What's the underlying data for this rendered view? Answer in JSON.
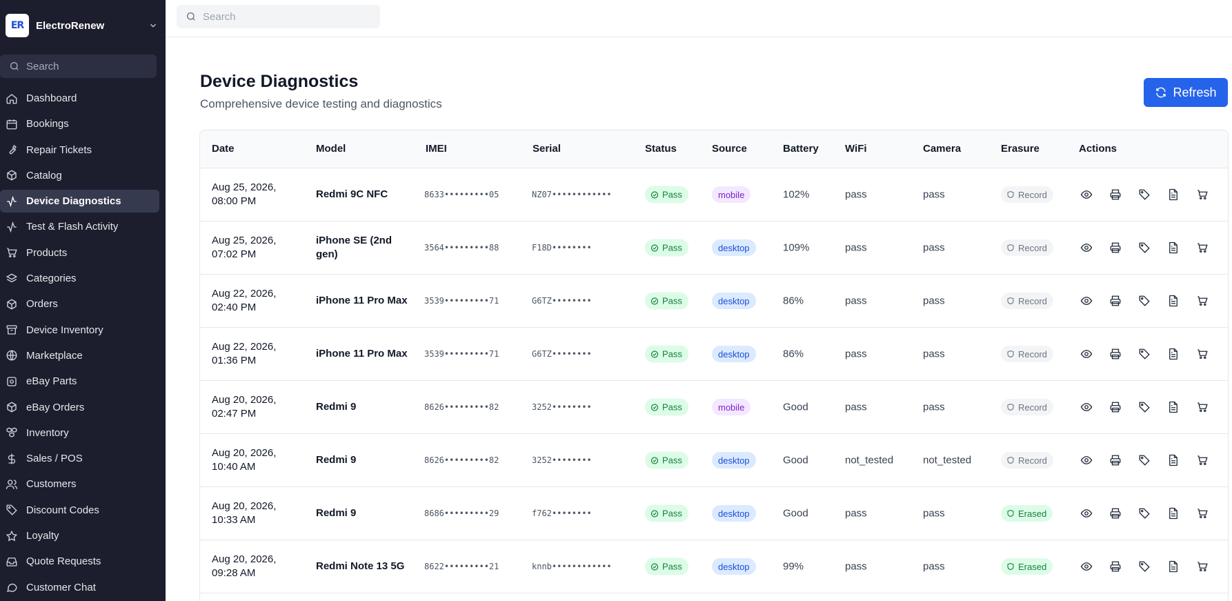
{
  "sidebar": {
    "brand_name": "ElectroRenew",
    "search_placeholder": "Search",
    "items": [
      {
        "label": "Dashboard",
        "icon": "home-icon"
      },
      {
        "label": "Bookings",
        "icon": "calendar-icon"
      },
      {
        "label": "Repair Tickets",
        "icon": "wrench-icon"
      },
      {
        "label": "Catalog",
        "icon": "box-icon"
      },
      {
        "label": "Device Diagnostics",
        "icon": "activity-icon",
        "active": true
      },
      {
        "label": "Test & Flash Activity",
        "icon": "activity-icon"
      },
      {
        "label": "Products",
        "icon": "cart-icon"
      },
      {
        "label": "Categories",
        "icon": "layers-icon"
      },
      {
        "label": "Orders",
        "icon": "box-icon"
      },
      {
        "label": "Device Inventory",
        "icon": "archive-icon"
      },
      {
        "label": "Marketplace",
        "icon": "globe-icon"
      },
      {
        "label": "eBay Parts",
        "icon": "settings-icon"
      },
      {
        "label": "eBay Orders",
        "icon": "box-icon"
      },
      {
        "label": "Inventory",
        "icon": "boxes-icon"
      },
      {
        "label": "Sales / POS",
        "icon": "dollar-icon"
      },
      {
        "label": "Customers",
        "icon": "users-icon"
      },
      {
        "label": "Discount Codes",
        "icon": "tag-icon"
      },
      {
        "label": "Loyalty",
        "icon": "star-icon"
      },
      {
        "label": "Quote Requests",
        "icon": "inbox-icon"
      },
      {
        "label": "Customer Chat",
        "icon": "chat-icon"
      }
    ]
  },
  "topbar": {
    "search_placeholder": "Search"
  },
  "header": {
    "title": "Device Diagnostics",
    "subtitle": "Comprehensive device testing and diagnostics",
    "refresh_label": "Refresh"
  },
  "table": {
    "columns": [
      "Date",
      "Model",
      "IMEI",
      "Serial",
      "Status",
      "Source",
      "Battery",
      "WiFi",
      "Camera",
      "Erasure",
      "Actions"
    ],
    "rows": [
      {
        "date": "Aug 25, 2026, 08:00 PM",
        "model": "Redmi 9C NFC",
        "imei": "8633•••••••••05",
        "serial": "NZ07••••••••••••",
        "status": "Pass",
        "source": "mobile",
        "battery": "102%",
        "wifi": "pass",
        "camera": "pass",
        "erasure": "Record"
      },
      {
        "date": "Aug 25, 2026, 07:02 PM",
        "model": "iPhone SE (2nd gen)",
        "imei": "3564•••••••••88",
        "serial": "F18D••••••••",
        "status": "Pass",
        "source": "desktop",
        "battery": "109%",
        "wifi": "pass",
        "camera": "pass",
        "erasure": "Record"
      },
      {
        "date": "Aug 22, 2026, 02:40 PM",
        "model": "iPhone 11 Pro Max",
        "imei": "3539•••••••••71",
        "serial": "G6TZ••••••••",
        "status": "Pass",
        "source": "desktop",
        "battery": "86%",
        "wifi": "pass",
        "camera": "pass",
        "erasure": "Record"
      },
      {
        "date": "Aug 22, 2026, 01:36 PM",
        "model": "iPhone 11 Pro Max",
        "imei": "3539•••••••••71",
        "serial": "G6TZ••••••••",
        "status": "Pass",
        "source": "desktop",
        "battery": "86%",
        "wifi": "pass",
        "camera": "pass",
        "erasure": "Record"
      },
      {
        "date": "Aug 20, 2026, 02:47 PM",
        "model": "Redmi 9",
        "imei": "8626•••••••••82",
        "serial": "3252••••••••",
        "status": "Pass",
        "source": "mobile",
        "battery": "Good",
        "wifi": "pass",
        "camera": "pass",
        "erasure": "Record"
      },
      {
        "date": "Aug 20, 2026, 10:40 AM",
        "model": "Redmi 9",
        "imei": "8626•••••••••82",
        "serial": "3252••••••••",
        "status": "Pass",
        "source": "desktop",
        "battery": "Good",
        "wifi": "not_tested",
        "camera": "not_tested",
        "erasure": "Record"
      },
      {
        "date": "Aug 20, 2026, 10:33 AM",
        "model": "Redmi 9",
        "imei": "8686•••••••••29",
        "serial": "f762••••••••",
        "status": "Pass",
        "source": "desktop",
        "battery": "Good",
        "wifi": "pass",
        "camera": "pass",
        "erasure": "Erased"
      },
      {
        "date": "Aug 20, 2026, 09:28 AM",
        "model": "Redmi Note 13 5G",
        "imei": "8622•••••••••21",
        "serial": "knnb••••••••••••",
        "status": "Pass",
        "source": "desktop",
        "battery": "99%",
        "wifi": "pass",
        "camera": "pass",
        "erasure": "Erased"
      }
    ],
    "action_icons": [
      "eye-icon",
      "printer-icon",
      "tag-icon",
      "document-icon",
      "cart-icon"
    ]
  },
  "colors": {
    "sidebar_bg": "#1c1e2e",
    "accent": "#2563eb",
    "pass_green": "#15803d",
    "mobile_purple": "#7e22ce",
    "desktop_blue": "#1d4ed8"
  }
}
